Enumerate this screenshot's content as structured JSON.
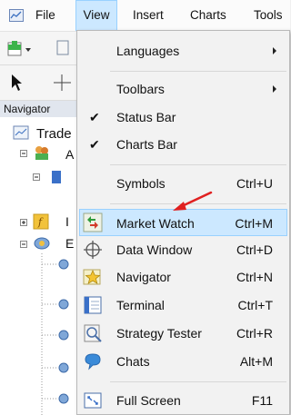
{
  "menubar": {
    "items": [
      {
        "label": "File"
      },
      {
        "label": "View"
      },
      {
        "label": "Insert"
      },
      {
        "label": "Charts"
      },
      {
        "label": "Tools"
      }
    ]
  },
  "navigator": {
    "title": "Navigator",
    "tree": [
      {
        "label": "Trade"
      },
      {
        "label": "A"
      },
      {
        "label": "I"
      },
      {
        "label": "E"
      }
    ]
  },
  "view_menu": {
    "items": [
      {
        "label": "Languages",
        "shortcut": "",
        "submenu": true
      },
      {
        "label": "Toolbars",
        "shortcut": "",
        "submenu": true
      },
      {
        "label": "Status Bar",
        "shortcut": "",
        "checked": true
      },
      {
        "label": "Charts Bar",
        "shortcut": "",
        "checked": true
      },
      {
        "label": "Symbols",
        "shortcut": "Ctrl+U"
      },
      {
        "label": "Market Watch",
        "shortcut": "Ctrl+M",
        "highlighted": true,
        "icon": "market-watch-icon"
      },
      {
        "label": "Data Window",
        "shortcut": "Ctrl+D",
        "icon": "crosshair-icon"
      },
      {
        "label": "Navigator",
        "shortcut": "Ctrl+N",
        "icon": "navigator-star-icon"
      },
      {
        "label": "Terminal",
        "shortcut": "Ctrl+T",
        "icon": "terminal-icon"
      },
      {
        "label": "Strategy Tester",
        "shortcut": "Ctrl+R",
        "icon": "strategy-tester-icon"
      },
      {
        "label": "Chats",
        "shortcut": "Alt+M",
        "icon": "chat-bubble-icon"
      },
      {
        "label": "Full Screen",
        "shortcut": "F11",
        "icon": "full-screen-icon"
      }
    ]
  },
  "colors": {
    "highlight": "#cce8ff",
    "highlight_border": "#99d1ff",
    "annotation_arrow": "#e02020"
  }
}
